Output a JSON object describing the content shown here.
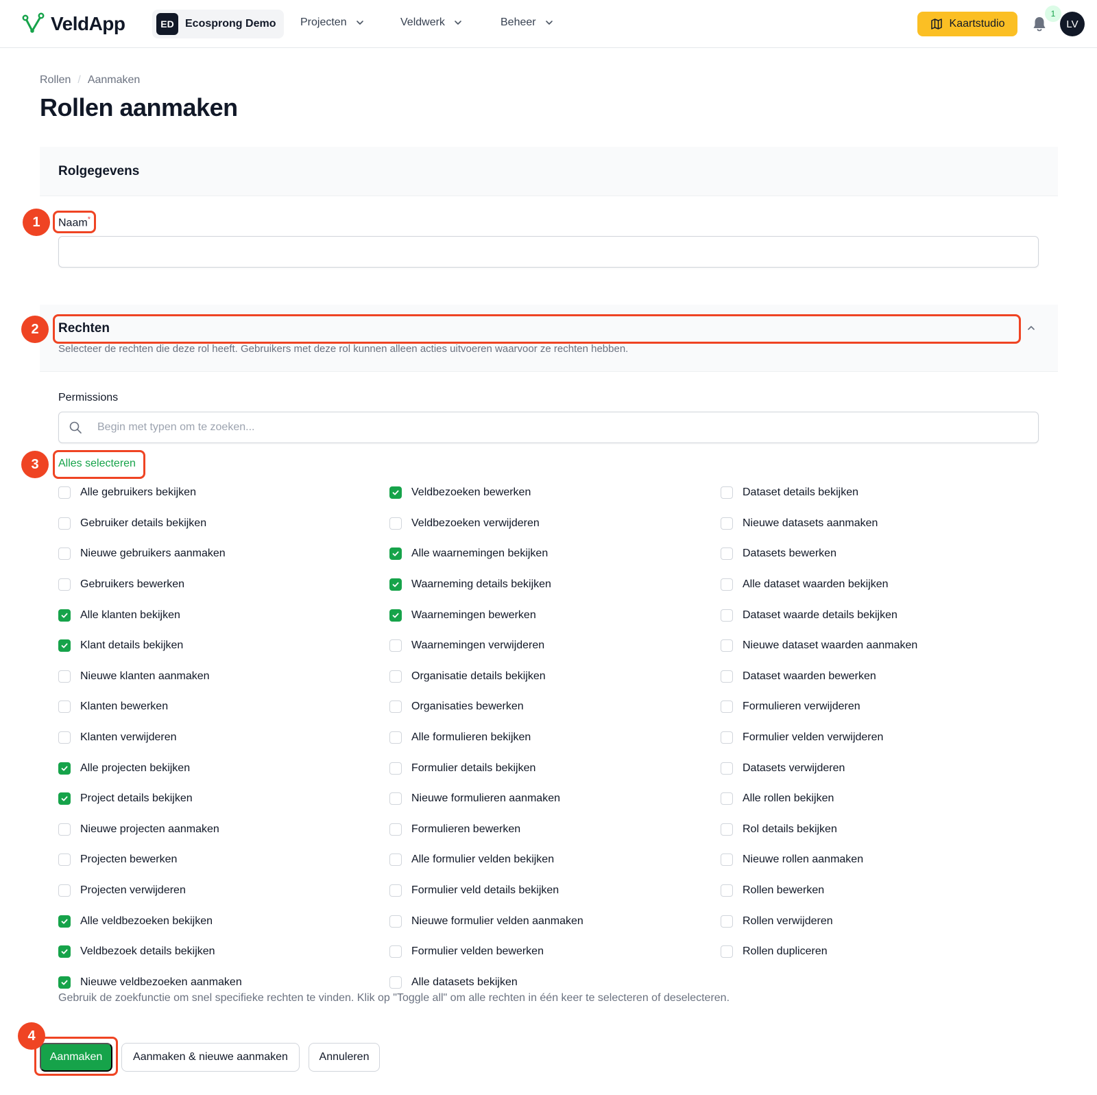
{
  "app": {
    "name": "VeldApp",
    "tenant_badge": "ED",
    "tenant_name": "Ecosprong Demo",
    "nav": [
      "Projecten",
      "Veldwerk",
      "Beheer"
    ],
    "studio_button": "Kaartstudio",
    "notification_count": "1",
    "user_initials": "LV",
    "accent_color": "#16a34a",
    "studio_color": "#fbbf24",
    "annotation_color": "#ef4423"
  },
  "breadcrumb": [
    "Rollen",
    "/",
    "Aanmaken"
  ],
  "page_title": "Rollen aanmaken",
  "section_rolgegevens": {
    "title": "Rolgegevens",
    "name_label": "Naam",
    "required_mark": "*",
    "name_value": ""
  },
  "section_rechten": {
    "title": "Rechten",
    "description": "Selecteer de rechten die deze rol heeft. Gebruikers met deze rol kunnen alleen acties uitvoeren waarvoor ze rechten hebben.",
    "permissions_label": "Permissions",
    "search_placeholder": "Begin met typen om te zoeken...",
    "select_all": "Alles selecteren",
    "help_text": "Gebruik de zoekfunctie om snel specifieke rechten te vinden. Klik op \"Toggle all\" om alle rechten in één keer te selecteren of deselecteren.",
    "columns": [
      [
        {
          "label": "Alle gebruikers bekijken",
          "checked": false
        },
        {
          "label": "Gebruiker details bekijken",
          "checked": false
        },
        {
          "label": "Nieuwe gebruikers aanmaken",
          "checked": false
        },
        {
          "label": "Gebruikers bewerken",
          "checked": false
        },
        {
          "label": "Alle klanten bekijken",
          "checked": true
        },
        {
          "label": "Klant details bekijken",
          "checked": true
        },
        {
          "label": "Nieuwe klanten aanmaken",
          "checked": false
        },
        {
          "label": "Klanten bewerken",
          "checked": false
        },
        {
          "label": "Klanten verwijderen",
          "checked": false
        },
        {
          "label": "Alle projecten bekijken",
          "checked": true
        },
        {
          "label": "Project details bekijken",
          "checked": true
        },
        {
          "label": "Nieuwe projecten aanmaken",
          "checked": false
        },
        {
          "label": "Projecten bewerken",
          "checked": false
        },
        {
          "label": "Projecten verwijderen",
          "checked": false
        },
        {
          "label": "Alle veldbezoeken bekijken",
          "checked": true
        },
        {
          "label": "Veldbezoek details bekijken",
          "checked": true
        },
        {
          "label": "Nieuwe veldbezoeken aanmaken",
          "checked": true
        }
      ],
      [
        {
          "label": "Veldbezoeken bewerken",
          "checked": true
        },
        {
          "label": "Veldbezoeken verwijderen",
          "checked": false
        },
        {
          "label": "Alle waarnemingen bekijken",
          "checked": true
        },
        {
          "label": "Waarneming details bekijken",
          "checked": true
        },
        {
          "label": "Waarnemingen bewerken",
          "checked": true
        },
        {
          "label": "Waarnemingen verwijderen",
          "checked": false
        },
        {
          "label": "Organisatie details bekijken",
          "checked": false
        },
        {
          "label": "Organisaties bewerken",
          "checked": false
        },
        {
          "label": "Alle formulieren bekijken",
          "checked": false
        },
        {
          "label": "Formulier details bekijken",
          "checked": false
        },
        {
          "label": "Nieuwe formulieren aanmaken",
          "checked": false
        },
        {
          "label": "Formulieren bewerken",
          "checked": false
        },
        {
          "label": "Alle formulier velden bekijken",
          "checked": false
        },
        {
          "label": "Formulier veld details bekijken",
          "checked": false
        },
        {
          "label": "Nieuwe formulier velden aanmaken",
          "checked": false
        },
        {
          "label": "Formulier velden bewerken",
          "checked": false
        },
        {
          "label": "Alle datasets bekijken",
          "checked": false
        }
      ],
      [
        {
          "label": "Dataset details bekijken",
          "checked": false
        },
        {
          "label": "Nieuwe datasets aanmaken",
          "checked": false
        },
        {
          "label": "Datasets bewerken",
          "checked": false
        },
        {
          "label": "Alle dataset waarden bekijken",
          "checked": false
        },
        {
          "label": "Dataset waarde details bekijken",
          "checked": false
        },
        {
          "label": "Nieuwe dataset waarden aanmaken",
          "checked": false
        },
        {
          "label": "Dataset waarden bewerken",
          "checked": false
        },
        {
          "label": "Formulieren verwijderen",
          "checked": false
        },
        {
          "label": "Formulier velden verwijderen",
          "checked": false
        },
        {
          "label": "Datasets verwijderen",
          "checked": false
        },
        {
          "label": "Alle rollen bekijken",
          "checked": false
        },
        {
          "label": "Rol details bekijken",
          "checked": false
        },
        {
          "label": "Nieuwe rollen aanmaken",
          "checked": false
        },
        {
          "label": "Rollen bewerken",
          "checked": false
        },
        {
          "label": "Rollen verwijderen",
          "checked": false
        },
        {
          "label": "Rollen dupliceren",
          "checked": false
        }
      ]
    ]
  },
  "actions": {
    "create": "Aanmaken",
    "create_and_new": "Aanmaken & nieuwe aanmaken",
    "cancel": "Annuleren"
  },
  "annotations": [
    "1",
    "2",
    "3",
    "4"
  ]
}
